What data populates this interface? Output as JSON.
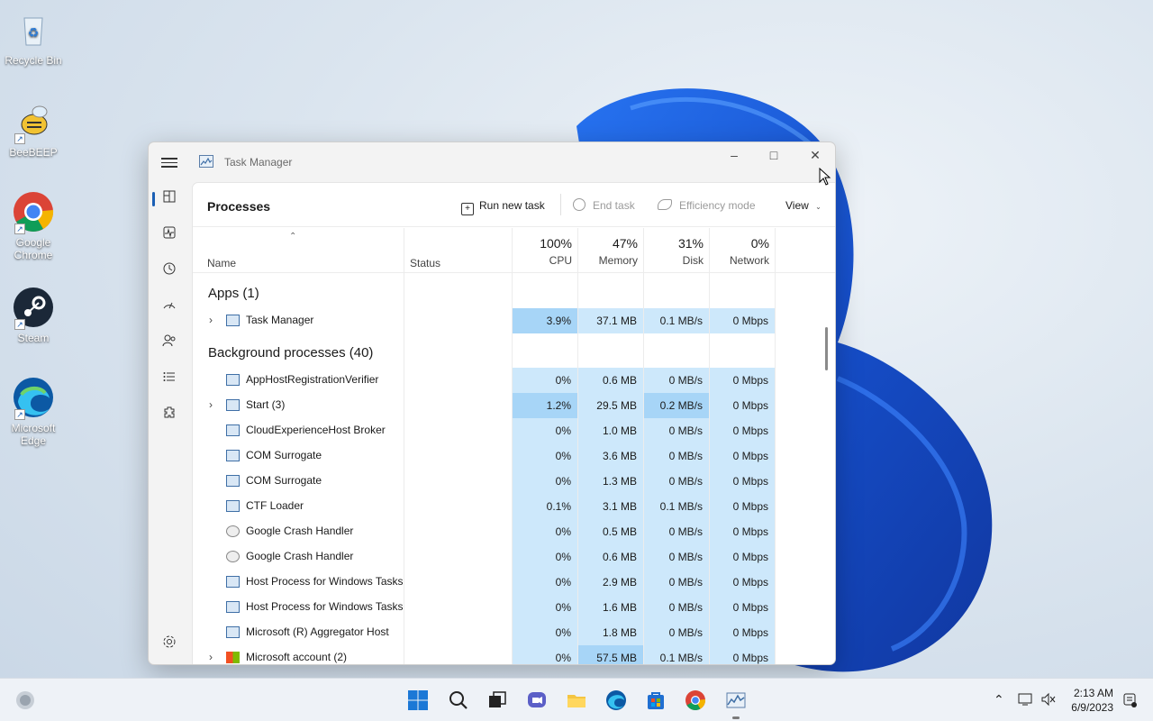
{
  "desktop": {
    "icons": [
      {
        "label": "Recycle Bin"
      },
      {
        "label": "BeeBEEP"
      },
      {
        "label": "Google Chrome"
      },
      {
        "label": "Steam"
      },
      {
        "label": "Microsoft Edge"
      }
    ]
  },
  "window": {
    "title": "Task Manager",
    "page_title": "Processes",
    "toolbar": {
      "run_new_task": "Run new task",
      "end_task": "End task",
      "efficiency_mode": "Efficiency mode",
      "view": "View"
    },
    "nav_icons": [
      "processes-icon",
      "performance-icon",
      "app-history-icon",
      "startup-apps-icon",
      "users-icon",
      "details-icon",
      "services-icon",
      "settings-icon"
    ],
    "columns": {
      "name": "Name",
      "status": "Status",
      "cpu": {
        "pct": "100%",
        "label": "CPU"
      },
      "memory": {
        "pct": "47%",
        "label": "Memory"
      },
      "disk": {
        "pct": "31%",
        "label": "Disk"
      },
      "network": {
        "pct": "0%",
        "label": "Network"
      }
    },
    "groups": {
      "apps": "Apps (1)",
      "background": "Background processes (40)"
    },
    "rows": [
      {
        "name": "Task Manager",
        "cpu": "3.9%",
        "mem": "37.1 MB",
        "disk": "0.1 MB/s",
        "net": "0 Mbps"
      },
      {
        "name": "AppHostRegistrationVerifier",
        "cpu": "0%",
        "mem": "0.6 MB",
        "disk": "0 MB/s",
        "net": "0 Mbps"
      },
      {
        "name": "Start (3)",
        "cpu": "1.2%",
        "mem": "29.5 MB",
        "disk": "0.2 MB/s",
        "net": "0 Mbps"
      },
      {
        "name": "CloudExperienceHost Broker",
        "cpu": "0%",
        "mem": "1.0 MB",
        "disk": "0 MB/s",
        "net": "0 Mbps"
      },
      {
        "name": "COM Surrogate",
        "cpu": "0%",
        "mem": "3.6 MB",
        "disk": "0 MB/s",
        "net": "0 Mbps"
      },
      {
        "name": "COM Surrogate",
        "cpu": "0%",
        "mem": "1.3 MB",
        "disk": "0 MB/s",
        "net": "0 Mbps"
      },
      {
        "name": "CTF Loader",
        "cpu": "0.1%",
        "mem": "3.1 MB",
        "disk": "0.1 MB/s",
        "net": "0 Mbps"
      },
      {
        "name": "Google Crash Handler",
        "cpu": "0%",
        "mem": "0.5 MB",
        "disk": "0 MB/s",
        "net": "0 Mbps"
      },
      {
        "name": "Google Crash Handler",
        "cpu": "0%",
        "mem": "0.6 MB",
        "disk": "0 MB/s",
        "net": "0 Mbps"
      },
      {
        "name": "Host Process for Windows Tasks",
        "cpu": "0%",
        "mem": "2.9 MB",
        "disk": "0 MB/s",
        "net": "0 Mbps"
      },
      {
        "name": "Host Process for Windows Tasks",
        "cpu": "0%",
        "mem": "1.6 MB",
        "disk": "0 MB/s",
        "net": "0 Mbps"
      },
      {
        "name": "Microsoft (R) Aggregator Host",
        "cpu": "0%",
        "mem": "1.8 MB",
        "disk": "0 MB/s",
        "net": "0 Mbps"
      },
      {
        "name": "Microsoft account (2)",
        "cpu": "0%",
        "mem": "57.5 MB",
        "disk": "0.1 MB/s",
        "net": "0 Mbps"
      }
    ]
  },
  "taskbar": {
    "time": "2:13 AM",
    "date": "6/9/2023"
  },
  "colors": {
    "accent": "#1a5fb4",
    "heat_low": "#cde8fb",
    "heat_high": "#a7d5f7"
  }
}
